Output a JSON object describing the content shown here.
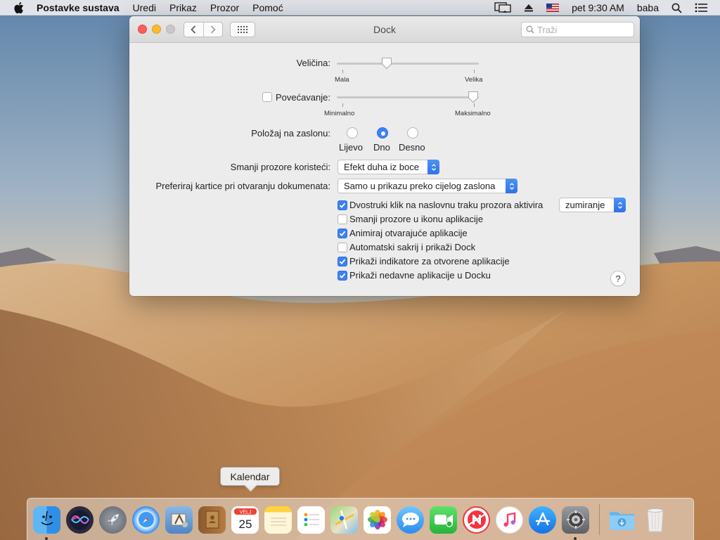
{
  "menubar": {
    "app_name": "Postavke sustava",
    "menus": [
      "Uredi",
      "Prikaz",
      "Prozor",
      "Pomoć"
    ],
    "clock": "pet 9:30 AM",
    "user": "baba"
  },
  "window": {
    "title": "Dock",
    "search_placeholder": "Traži"
  },
  "size": {
    "label": "Veličina:",
    "min_label": "Mala",
    "max_label": "Velika",
    "value": 0.34
  },
  "magnification": {
    "label": "Povećavanje:",
    "checked": false,
    "min_label": "Minimalno",
    "max_label": "Maksimalno",
    "value": 1.0
  },
  "position": {
    "label": "Položaj na zaslonu:",
    "options": [
      "Lijevo",
      "Dno",
      "Desno"
    ],
    "selected": "Dno"
  },
  "minimize_effect": {
    "label": "Smanji prozore koristeći:",
    "value": "Efekt duha iz boce"
  },
  "prefer_tabs": {
    "label": "Preferiraj kartice pri otvaranju dokumenata:",
    "value": "Samo u prikazu preko cijelog zaslona"
  },
  "checkboxes": [
    {
      "label": "Dvostruki klik na naslovnu traku prozora aktivira",
      "checked": true
    },
    {
      "label": "Smanji prozore u ikonu aplikacije",
      "checked": false
    },
    {
      "label": "Animiraj otvarajuće aplikacije",
      "checked": true
    },
    {
      "label": "Automatski sakrij i prikaži Dock",
      "checked": false
    },
    {
      "label": "Prikaži indikatore za otvorene aplikacije",
      "checked": true
    },
    {
      "label": "Prikaži nedavne aplikacije u Docku",
      "checked": true
    }
  ],
  "double_click_action": "zumiranje",
  "help_label": "?",
  "tooltip": "Kalendar",
  "calendar_icon": {
    "month": "VELJ",
    "day": "25"
  },
  "dock_apps": [
    {
      "name": "finder-icon",
      "running": true
    },
    {
      "name": "siri-icon",
      "running": false
    },
    {
      "name": "launchpad-icon",
      "running": false
    },
    {
      "name": "safari-icon",
      "running": false
    },
    {
      "name": "mail-icon",
      "running": false
    },
    {
      "name": "contacts-icon",
      "running": false
    },
    {
      "name": "calendar-icon",
      "running": false
    },
    {
      "name": "notes-icon",
      "running": false
    },
    {
      "name": "reminders-icon",
      "running": false
    },
    {
      "name": "maps-icon",
      "running": false
    },
    {
      "name": "photos-icon",
      "running": false
    },
    {
      "name": "messages-icon",
      "running": false
    },
    {
      "name": "facetime-icon",
      "running": false
    },
    {
      "name": "news-icon",
      "running": false
    },
    {
      "name": "music-icon",
      "running": false
    },
    {
      "name": "app-store-icon",
      "running": false
    },
    {
      "name": "system-preferences-icon",
      "running": true
    }
  ],
  "colors": {
    "accent": "#3b82f6",
    "close": "#fc5f57",
    "minimize": "#fdbc2e"
  }
}
